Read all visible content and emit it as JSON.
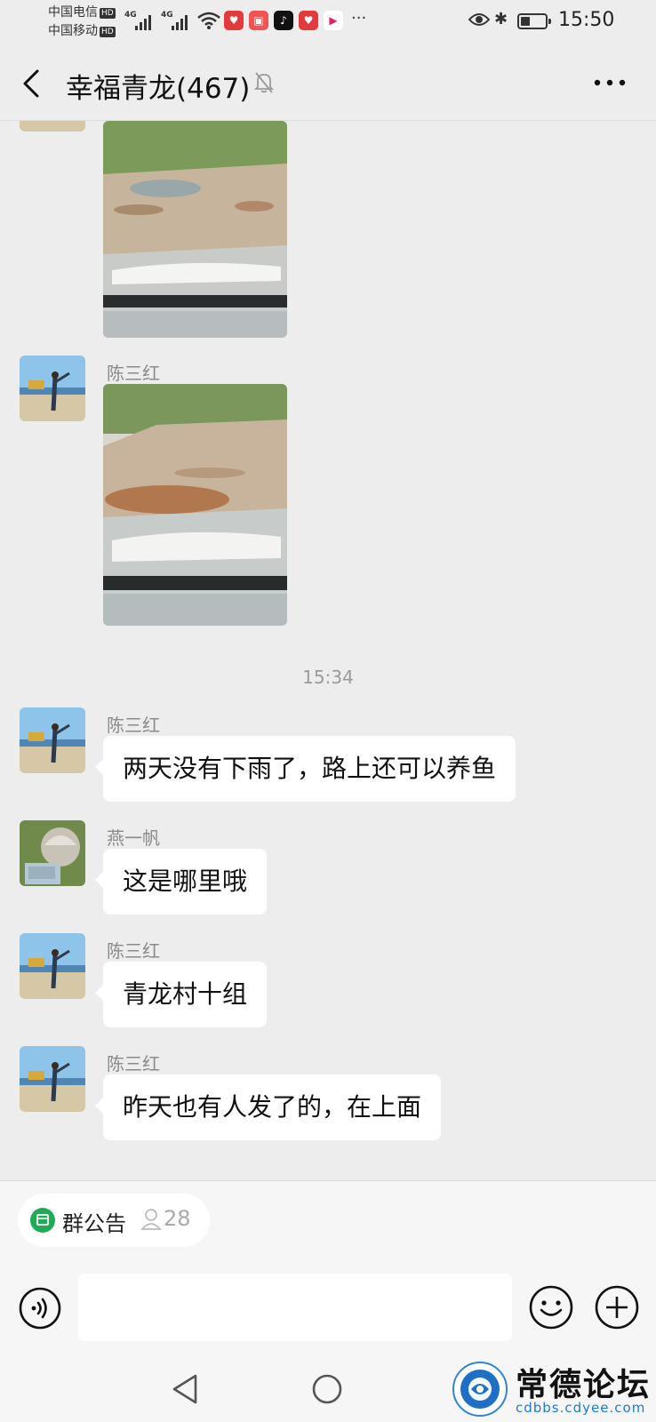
{
  "status_bar": {
    "carrier1": "中国电信",
    "carrier2": "中国移动",
    "hd_badge": "HD",
    "network1": "4G",
    "network2": "4G",
    "overflow": "···",
    "time": "15:50",
    "app_icons": [
      "heart-app-icon",
      "book-app-icon",
      "tiktok-icon",
      "heart-app-icon",
      "play-app-icon"
    ]
  },
  "header": {
    "title": "幸福青龙(467)",
    "icons": [
      "back-arrow-icon",
      "mute-bell-icon",
      "more-dots-icon"
    ]
  },
  "messages": [
    {
      "type": "image",
      "sender": "",
      "avatar": "beach-avatar"
    },
    {
      "type": "image",
      "sender": "陈三红",
      "avatar": "beach-avatar"
    },
    {
      "type": "text",
      "sender": "陈三红",
      "text": "两天没有下雨了，路上还可以养鱼",
      "avatar": "beach-avatar"
    },
    {
      "type": "text",
      "sender": "燕一帆",
      "text": "这是哪里哦",
      "avatar": "helmet-avatar"
    },
    {
      "type": "text",
      "sender": "陈三红",
      "text": "青龙村十组",
      "avatar": "beach-avatar"
    },
    {
      "type": "text",
      "sender": "陈三红",
      "text": "昨天也有人发了的，在上面",
      "avatar": "beach-avatar"
    }
  ],
  "timestamp": "15:34",
  "footer": {
    "notice_label": "群公告",
    "notice_count": "28",
    "input_value": "",
    "icons": [
      "voice-icon",
      "emoji-icon",
      "plus-icon"
    ]
  },
  "nav_bar": {
    "icons": [
      "nav-back-icon",
      "nav-home-icon"
    ]
  },
  "watermark": {
    "text": "常德论坛",
    "url": "cdbbs.cdyee.com"
  },
  "colors": {
    "background": "#ededed",
    "bubble": "#ffffff",
    "accent_green": "#21a957",
    "sender_gray": "#8a8a8a"
  }
}
